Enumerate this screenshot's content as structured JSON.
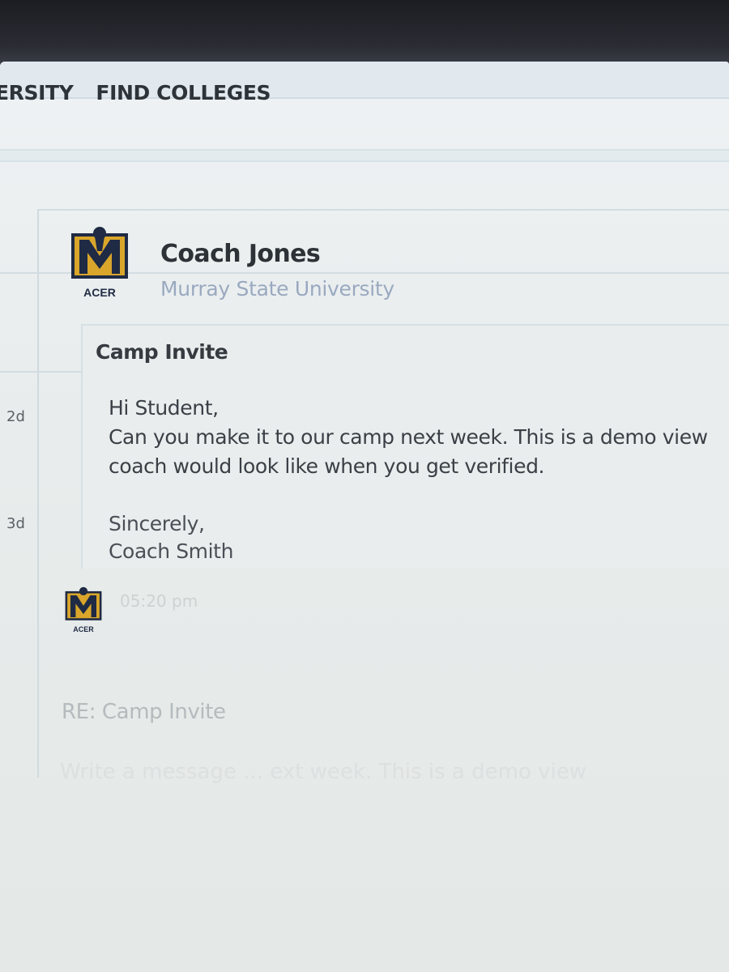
{
  "nav": {
    "items": [
      {
        "label": "ERSITY"
      },
      {
        "label": "FIND COLLEGES"
      }
    ]
  },
  "message": {
    "sender_name": "Coach Jones",
    "sender_school": "Murray State University",
    "subject": "Camp Invite",
    "lines": [
      "Hi Student,",
      "Can you make it to our camp next week. This is a demo view",
      "coach would look like when you get verified."
    ],
    "signoff": "Sincerely,",
    "signature": "Coach Smith",
    "timestamps": {
      "first": "2d",
      "second": "3d"
    }
  },
  "reply": {
    "time": "05:20 pm",
    "subject": "RE: Camp Invite",
    "body": "Write a message ... ext week. This is a demo view"
  },
  "logo": {
    "letter": "M",
    "caption": "ACER",
    "gold": "#d9a62b",
    "navy": "#1f2a44"
  }
}
